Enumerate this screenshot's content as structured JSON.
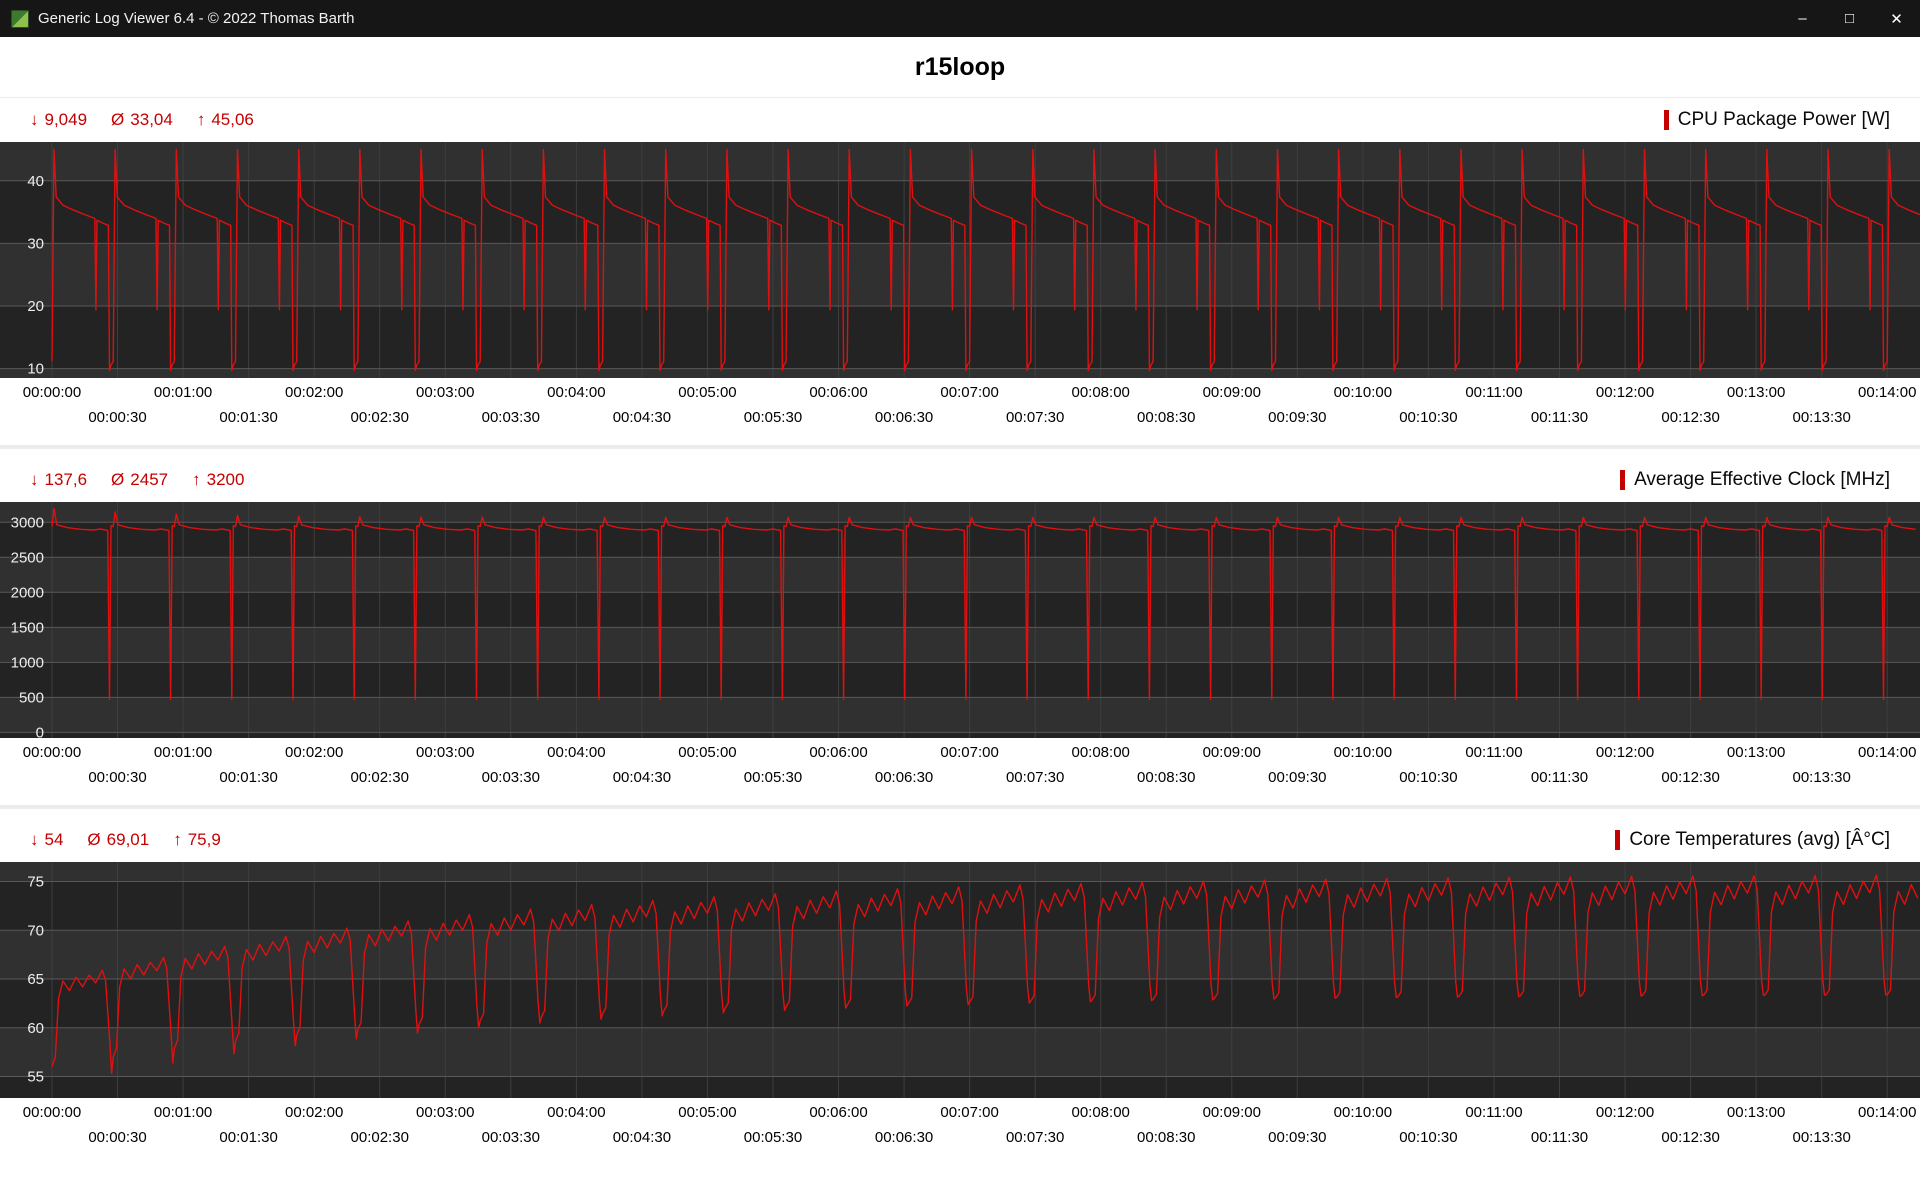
{
  "window": {
    "title": "Generic Log Viewer 6.4 - © 2022 Thomas Barth",
    "controls": {
      "minimize": "–",
      "maximize": "□",
      "close": "✕"
    }
  },
  "header": {
    "title": "r15loop"
  },
  "stats_symbols": {
    "min": "↓",
    "avg": "Ø",
    "max": "↑"
  },
  "x_axis": {
    "duration_s": 855,
    "minor_step_s": 30,
    "row1": {
      "start_s": 0,
      "step_s": 60,
      "labels": [
        "00:00:00",
        "00:01:00",
        "00:02:00",
        "00:03:00",
        "00:04:00",
        "00:05:00",
        "00:06:00",
        "00:07:00",
        "00:08:00",
        "00:09:00",
        "00:10:00",
        "00:11:00",
        "00:12:00",
        "00:13:00",
        "00:14:00"
      ]
    },
    "row2": {
      "start_s": 30,
      "step_s": 60,
      "labels": [
        "00:00:30",
        "00:01:30",
        "00:02:30",
        "00:03:30",
        "00:04:30",
        "00:05:30",
        "00:06:30",
        "00:07:30",
        "00:08:30",
        "00:09:30",
        "00:10:30",
        "00:11:30",
        "00:12:30",
        "00:13:30"
      ]
    }
  },
  "chart_data": [
    {
      "type": "line",
      "title": "CPU Package Power [W]",
      "stats": {
        "min": "9,049",
        "avg": "33,04",
        "max": "45,06"
      },
      "stats_numeric": {
        "min": 9.049,
        "avg": 33.04,
        "max": 45.06
      },
      "line_color": "#e01010",
      "accent_color": "#c40000",
      "y_ticks": [
        10,
        20,
        30,
        40
      ],
      "y_min": 8.5,
      "y_max": 46.2,
      "grid": true,
      "legend_position": "top-right",
      "wave": {
        "period_s": 28,
        "ramp_tau_cycles": 1,
        "points": [
          [
            0.0,
            11.2
          ],
          [
            0.9,
            45.0
          ],
          [
            1.9,
            37.4
          ],
          [
            5.0,
            36.1
          ],
          [
            10.0,
            35.3
          ],
          [
            15.0,
            34.6
          ],
          [
            19.6,
            34.0
          ],
          [
            20.1,
            19.4
          ],
          [
            20.6,
            33.7
          ],
          [
            23.5,
            33.2
          ],
          [
            25.8,
            32.9
          ],
          [
            26.3,
            9.7
          ],
          [
            27.0,
            10.6
          ],
          [
            27.8,
            11.0
          ]
        ]
      }
    },
    {
      "type": "line",
      "title": "Average Effective Clock [MHz]",
      "stats": {
        "min": "137,6",
        "avg": "2457",
        "max": "3200"
      },
      "stats_numeric": {
        "min": 137.6,
        "avg": 2457,
        "max": 3200
      },
      "line_color": "#e01010",
      "accent_color": "#c40000",
      "y_ticks": [
        0,
        500,
        1000,
        1500,
        2000,
        2500,
        3000
      ],
      "y_min": -80,
      "y_max": 3290,
      "grid": true,
      "legend_position": "top-right",
      "wave": {
        "period_s": 28,
        "ramp_tau_cycles": 2,
        "points": [
          [
            0.0,
            2940
          ],
          [
            0.9,
            3200,
            -130
          ],
          [
            2.2,
            2965
          ],
          [
            7.0,
            2925
          ],
          [
            13.0,
            2900
          ],
          [
            19.0,
            2890
          ],
          [
            22.0,
            2905
          ],
          [
            25.5,
            2885
          ],
          [
            26.3,
            470
          ],
          [
            27.0,
            2950
          ]
        ]
      }
    },
    {
      "type": "line",
      "title": "Core Temperatures (avg) [Â°C]",
      "stats": {
        "min": "54",
        "avg": "69,01",
        "max": "75,9"
      },
      "stats_numeric": {
        "min": 54,
        "avg": 69.01,
        "max": 75.9
      },
      "line_color": "#e01010",
      "accent_color": "#c40000",
      "y_ticks": [
        55,
        60,
        65,
        70,
        75
      ],
      "y_min": 52.8,
      "y_max": 77,
      "grid": true,
      "legend_position": "top-right",
      "wave": {
        "period_s": 28,
        "ramp_tau_cycles": 7,
        "points": [
          [
            0.0,
            56.0,
            7.5
          ],
          [
            1.5,
            57.0,
            7.0
          ],
          [
            3.0,
            63.0,
            9.0
          ],
          [
            5.0,
            64.8,
            9.3
          ],
          [
            8.0,
            63.8,
            9.0
          ],
          [
            11.0,
            65.2,
            9.6
          ],
          [
            14.0,
            64.2,
            9.2
          ],
          [
            17.0,
            65.4,
            9.8
          ],
          [
            20.0,
            64.6,
            9.4
          ],
          [
            23.0,
            65.9,
            9.9
          ],
          [
            24.5,
            64.9,
            9.4
          ],
          [
            26.5,
            58.5,
            6.5
          ],
          [
            27.3,
            55.3,
            8.2
          ]
        ]
      }
    }
  ]
}
